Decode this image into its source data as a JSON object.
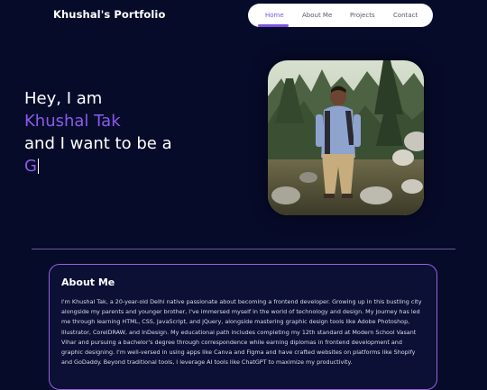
{
  "header": {
    "brand": "Khushal's Portfolio",
    "nav": [
      {
        "label": "Home",
        "active": true
      },
      {
        "label": "About Me",
        "active": false
      },
      {
        "label": "Projects",
        "active": false
      },
      {
        "label": "Contact",
        "active": false
      }
    ]
  },
  "hero": {
    "line1": "Hey, I am",
    "name": "Khushal Tak",
    "line3": "and I want to be a",
    "typed": "G",
    "accent_color": "#8a5be8",
    "photo_alt": "Khushal standing in a forest"
  },
  "about": {
    "title": "About Me",
    "body": "I'm Khushal Tak, a 20-year-old Delhi native passionate about becoming a frontend developer. Growing up in this bustling city alongside my parents and younger brother, I've immersed myself in the world of technology and design. My journey has led me through learning HTML, CSS, JavaScript, and jQuery, alongside mastering graphic design tools like Adobe Photoshop, Illustrator, CorelDRAW, and InDesign. My educational path includes completing my 12th standard at Modern School Vasant Vihar and pursuing a bachelor's degree through correspondence while earning diplomas in frontend development and graphic designing. I'm well-versed in using apps like Canva and Figma and have crafted websites on platforms like Shopify and GoDaddy. Beyond traditional tools, I leverage AI tools like ChatGPT to maximize my productivity."
  },
  "colors": {
    "background": "#070b2a",
    "accent": "#7a55e0",
    "card_border": "#9b5fe0"
  }
}
